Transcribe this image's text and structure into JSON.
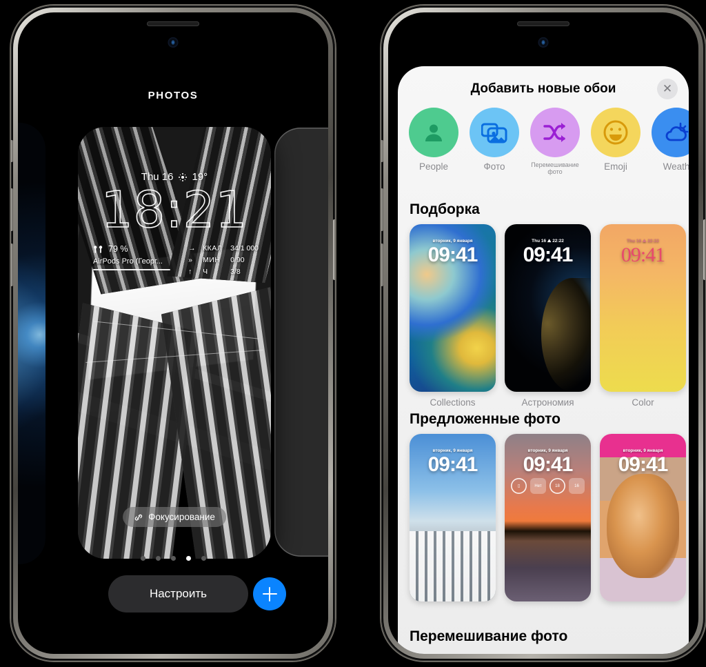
{
  "left_phone": {
    "screen_title": "PHOTOS",
    "lock_screen": {
      "date": "Thu 16",
      "weather_icon": "sun-icon",
      "temperature": "19°",
      "time": "18:21",
      "battery_widget": {
        "icon": "airpods-icon",
        "percent": "79 %",
        "device": "AirPods Pro (Георг..."
      },
      "fitness_widget": {
        "rows": [
          {
            "icon": "→",
            "label": "ККАЛ",
            "value": "34/1 000"
          },
          {
            "icon": "»",
            "label": "МИН",
            "value": "0/90"
          },
          {
            "icon": "↑",
            "label": "Ч",
            "value": "3/8"
          }
        ]
      },
      "focus_pill": {
        "icon": "link-icon",
        "label": "Фокусирование"
      }
    },
    "page_dots": {
      "count": 5,
      "active_index": 3
    },
    "customize_button": "Настроить",
    "add_button": "add-icon"
  },
  "right_phone": {
    "sheet": {
      "title": "Добавить новые обои",
      "close_label": "✕",
      "categories": [
        {
          "name": "People",
          "label": "People",
          "icon": "person-icon",
          "bg": "#4ECB8F",
          "fg": "#1E9B63"
        },
        {
          "name": "photo",
          "label": "Фото",
          "icon": "photos-icon",
          "bg": "#6CC4F5",
          "fg": "#0A6EE0"
        },
        {
          "name": "shuffle",
          "label": "Перемешивание фото",
          "icon": "shuffle-icon",
          "bg": "#D79BF0",
          "fg": "#9A1FD4"
        },
        {
          "name": "emoji",
          "label": "Emoji",
          "icon": "emoji-icon",
          "bg": "#F4D65C",
          "fg": "#D89A0B"
        },
        {
          "name": "weather",
          "label": "Weath",
          "icon": "weather-icon",
          "bg": "#3A8EF0",
          "fg": "#0A3FD0"
        }
      ],
      "sections": [
        {
          "title": "Подборка",
          "items": [
            {
              "label": "Collections",
              "style": "w-coll",
              "date": "вторник, 9 января",
              "time": "09:41"
            },
            {
              "label": "Астрономия",
              "style": "w-astro",
              "date": "Thu 16 ⛰ 22:22",
              "time": "09:41"
            },
            {
              "label": "Color",
              "style": "w-color",
              "date": "Thu 16 ⛰ 22:22",
              "time": "09:41"
            },
            {
              "label": "",
              "style": "w-emoji",
              "date": "",
              "time": ""
            }
          ]
        },
        {
          "title": "Предложенные фото",
          "items": [
            {
              "label": "",
              "style": "w-city",
              "date": "вторник, 9 января",
              "time": "09:41"
            },
            {
              "label": "",
              "style": "w-sunset",
              "date": "вторник, 9 января",
              "time": "09:41",
              "chips": [
                "chip-battery",
                "Нет",
                "18",
                "16"
              ]
            },
            {
              "label": "",
              "style": "w-cat",
              "date": "вторник, 9 января",
              "time": "09:41"
            },
            {
              "label": "",
              "style": "w-partial",
              "date": "",
              "time": ""
            }
          ]
        },
        {
          "title": "Перемешивание фото",
          "items": []
        }
      ]
    }
  }
}
